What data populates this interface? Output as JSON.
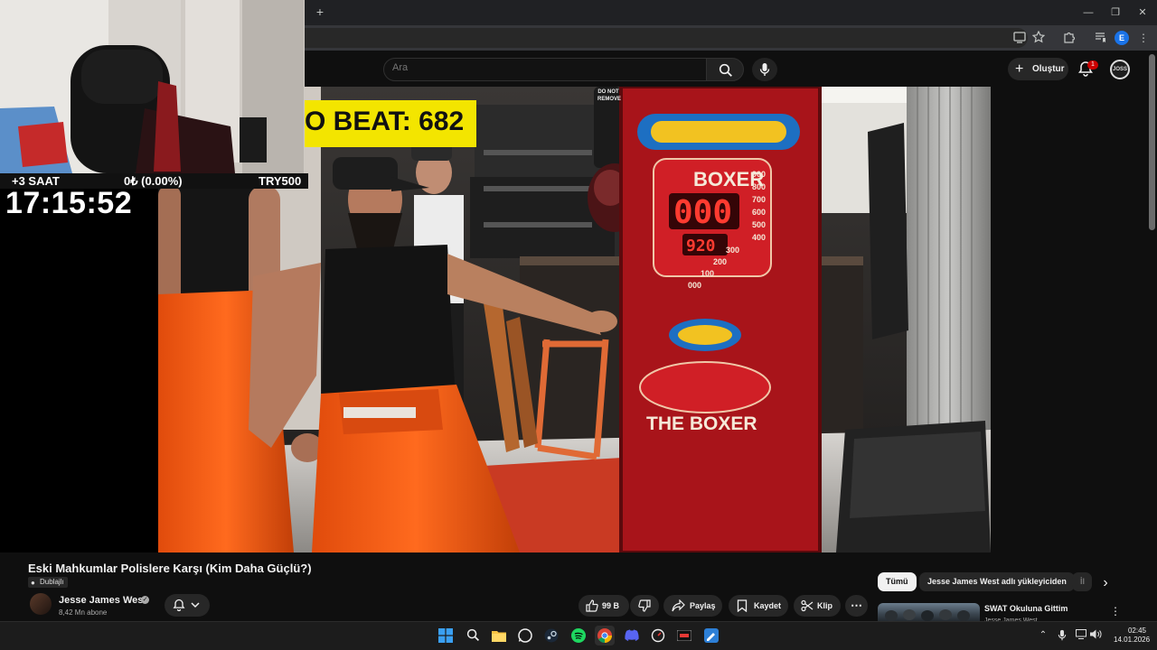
{
  "browser": {
    "new_tab_symbol": "+",
    "window_controls": [
      "—",
      "❐",
      "✕"
    ]
  },
  "youtube": {
    "search": {
      "placeholder": "Ara"
    },
    "create_label": "Oluştur",
    "notification_count": "1",
    "account_initials": "JOSS"
  },
  "video_overlay": {
    "score_banner": "O BEAT: 682",
    "machine_top": "BOXER",
    "machine_digits": "000",
    "machine_score": "920",
    "machine_scale": [
      "900",
      "800",
      "700",
      "600",
      "500",
      "400",
      "300",
      "200",
      "100",
      "000"
    ],
    "machine_sign": "THE BOXER",
    "side_sticker": "DO NOT REMOVE"
  },
  "stream": {
    "extra_time": "+3 SAAT",
    "earnings": "0₺ (0.00%)",
    "goal": "TRY500",
    "clock": "17:15:52"
  },
  "video": {
    "title": "Eski Mahkumlar Polislere Karşı (Kim Daha Güçlü?)",
    "dubbed_label": "Dublajlı",
    "channel_name": "Jesse James West",
    "subscribers": "8,42 Mn abone",
    "likes": "99 B",
    "share_label": "Paylaş",
    "save_label": "Kaydet",
    "clip_label": "Klip"
  },
  "recommendations": {
    "chips": [
      "Tümü",
      "Jesse James West adlı yükleyiciden",
      "İl"
    ],
    "items": [
      {
        "title": "SWAT Okuluna Gittim",
        "channel": "Jesse James West"
      }
    ]
  },
  "taskbar": {
    "time": "02:45",
    "date": "14.01.2026"
  },
  "colors": {
    "yt_bg": "#0f0f0f",
    "banner_yellow": "#f3e500",
    "machine_red": "#a8141a",
    "prison_orange": "#f05a12",
    "taskbar": "#1c1c1c"
  }
}
